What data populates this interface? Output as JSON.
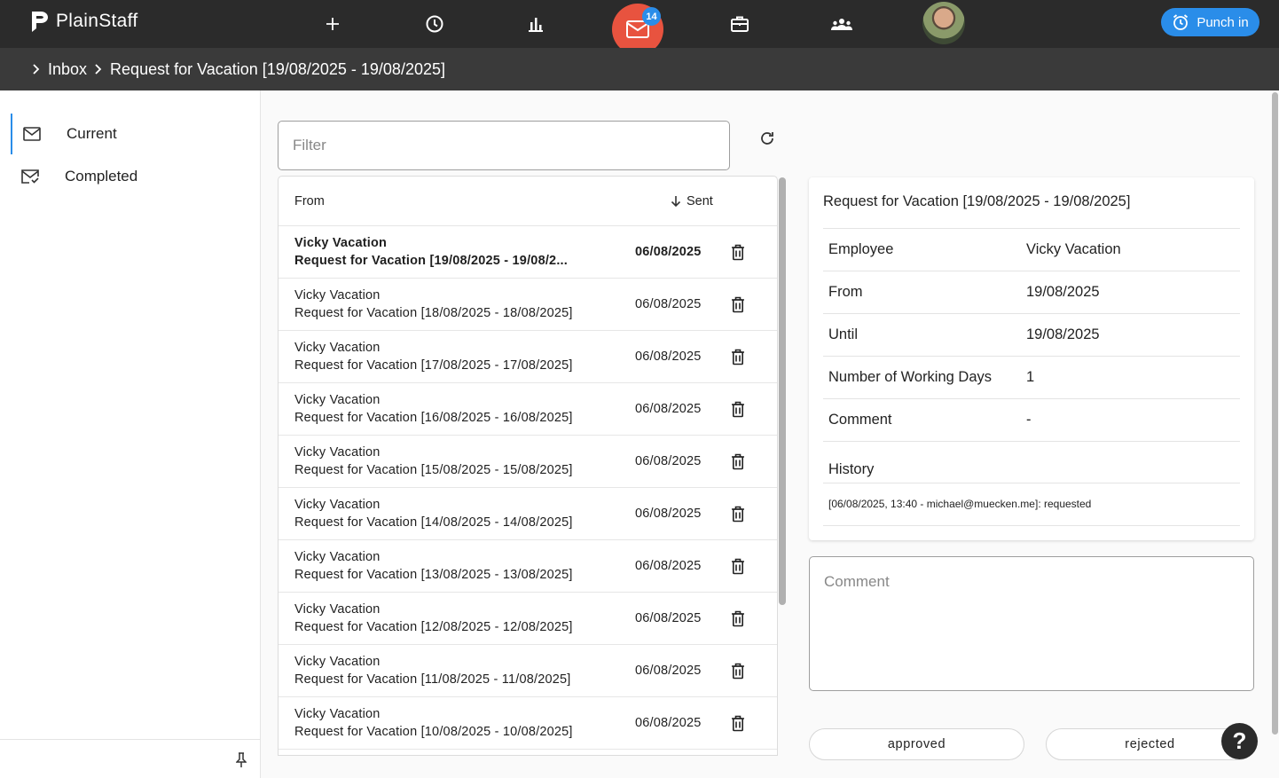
{
  "app": {
    "name": "PlainStaff"
  },
  "nav": {
    "unread_count": "14",
    "punch_label": "Punch in",
    "icons": [
      "plus-icon",
      "clock-icon",
      "bar-chart-icon",
      "mail-icon",
      "briefcase-icon",
      "team-icon"
    ]
  },
  "breadcrumb": {
    "items": [
      "Inbox",
      "Request for Vacation [19/08/2025 - 19/08/2025]"
    ]
  },
  "sidebar": {
    "items": [
      {
        "label": "Current",
        "active": true
      },
      {
        "label": "Completed",
        "active": false
      }
    ]
  },
  "filter": {
    "placeholder": "Filter"
  },
  "list": {
    "headers": {
      "from": "From",
      "sent": "Sent"
    },
    "rows": [
      {
        "from": "Vicky Vacation",
        "subject": "Request for Vacation [19/08/2025 - 19/08/2...",
        "date": "06/08/2025",
        "unread": true
      },
      {
        "from": "Vicky Vacation",
        "subject": "Request for Vacation [18/08/2025 - 18/08/2025]",
        "date": "06/08/2025",
        "unread": false
      },
      {
        "from": "Vicky Vacation",
        "subject": "Request for Vacation [17/08/2025 - 17/08/2025]",
        "date": "06/08/2025",
        "unread": false
      },
      {
        "from": "Vicky Vacation",
        "subject": "Request for Vacation [16/08/2025 - 16/08/2025]",
        "date": "06/08/2025",
        "unread": false
      },
      {
        "from": "Vicky Vacation",
        "subject": "Request for Vacation [15/08/2025 - 15/08/2025]",
        "date": "06/08/2025",
        "unread": false
      },
      {
        "from": "Vicky Vacation",
        "subject": "Request for Vacation [14/08/2025 - 14/08/2025]",
        "date": "06/08/2025",
        "unread": false
      },
      {
        "from": "Vicky Vacation",
        "subject": "Request for Vacation [13/08/2025 - 13/08/2025]",
        "date": "06/08/2025",
        "unread": false
      },
      {
        "from": "Vicky Vacation",
        "subject": "Request for Vacation [12/08/2025 - 12/08/2025]",
        "date": "06/08/2025",
        "unread": false
      },
      {
        "from": "Vicky Vacation",
        "subject": "Request for Vacation [11/08/2025 - 11/08/2025]",
        "date": "06/08/2025",
        "unread": false
      },
      {
        "from": "Vicky Vacation",
        "subject": "Request for Vacation [10/08/2025 - 10/08/2025]",
        "date": "06/08/2025",
        "unread": false
      }
    ]
  },
  "detail": {
    "title": "Request for Vacation [19/08/2025 - 19/08/2025]",
    "fields": [
      {
        "label": "Employee",
        "value": "Vicky Vacation"
      },
      {
        "label": "From",
        "value": "19/08/2025"
      },
      {
        "label": "Until",
        "value": "19/08/2025"
      },
      {
        "label": "Number of Working Days",
        "value": "1"
      },
      {
        "label": "Comment",
        "value": "-"
      }
    ],
    "history_label": "History",
    "history": [
      "[06/08/2025, 13:40 - michael@muecken.me]: requested"
    ]
  },
  "comment": {
    "placeholder": "Comment"
  },
  "actions": {
    "approve": "approved",
    "reject": "rejected"
  },
  "help": {
    "label": "?"
  },
  "colors": {
    "topbar": "#2b2b2b",
    "accent": "#2a8de9",
    "mail": "#e8533f"
  }
}
